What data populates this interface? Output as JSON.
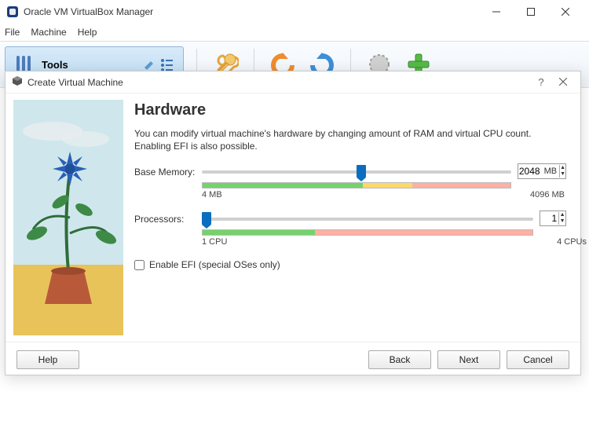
{
  "window": {
    "title": "Oracle VM VirtualBox Manager",
    "menu": {
      "file": "File",
      "machine": "Machine",
      "help": "Help"
    },
    "tools_label": "Tools"
  },
  "dialog": {
    "title": "Create Virtual Machine",
    "heading": "Hardware",
    "description": "You can modify virtual machine's hardware by changing amount of RAM and virtual CPU count. Enabling EFI is also possible.",
    "memory": {
      "label": "Base Memory:",
      "value": "2048",
      "unit": "MB",
      "min_label": "4 MB",
      "max_label": "4096 MB",
      "thumb_pct": 50,
      "bar_segments": [
        {
          "color": "#74d36b",
          "pct": 52
        },
        {
          "color": "#ffd86b",
          "pct": 16
        },
        {
          "color": "#ffb0a3",
          "pct": 32
        }
      ]
    },
    "processors": {
      "label": "Processors:",
      "value": "1",
      "min_label": "1 CPU",
      "max_label": "4 CPUs",
      "thumb_pct": 0,
      "bar_segments": [
        {
          "color": "#74d36b",
          "pct": 34
        },
        {
          "color": "#ffb0a3",
          "pct": 66
        }
      ]
    },
    "efi_label": "Enable EFI (special OSes only)",
    "buttons": {
      "help": "Help",
      "back": "Back",
      "next": "Next",
      "cancel": "Cancel"
    }
  }
}
